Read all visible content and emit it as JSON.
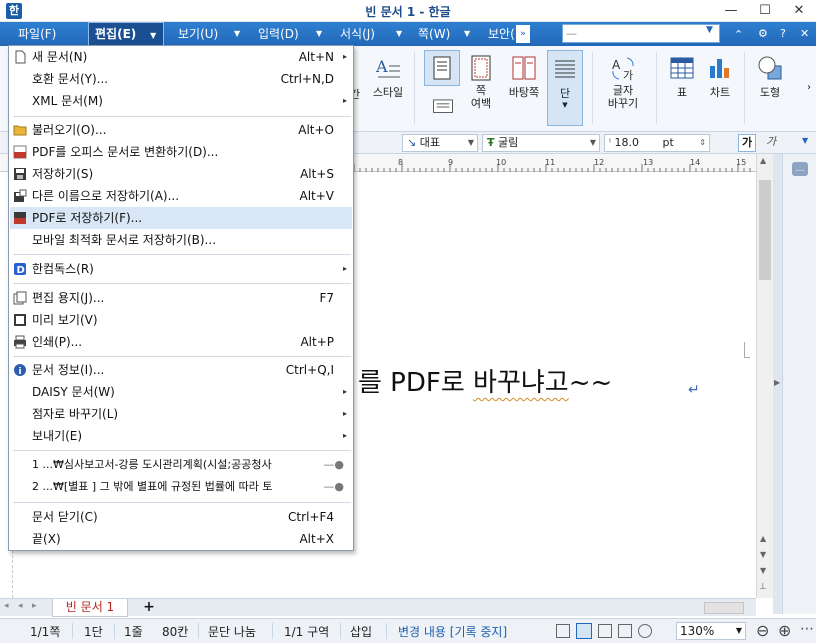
{
  "window": {
    "title": "빈 문서 1 - 한글",
    "app_icon_glyph": "한",
    "minimize": "—",
    "maximize": "☐",
    "close": "✕"
  },
  "menubar": {
    "items": [
      "파일(F)",
      "편집(E)",
      "보기(U)",
      "입력(D)",
      "서식(J)",
      "쪽(W)",
      "보안("
    ],
    "active_index": 1,
    "more_glyph": "»",
    "search_placeholder": "—",
    "right_controls": [
      "⌃",
      "⚙",
      "?",
      "✕"
    ]
  },
  "ribbon": {
    "buttons": [
      {
        "label": "스타일",
        "icon": "style-icon"
      },
      {
        "label": "",
        "icon": "page-layout-icon"
      },
      {
        "label": "쪽\n여백",
        "icon": "page-margin-icon"
      },
      {
        "label": "바탕쪽",
        "icon": "master-page-icon"
      },
      {
        "label": "단",
        "icon": "columns-icon"
      },
      {
        "label": "글자\n바꾸기",
        "icon": "char-replace-icon"
      },
      {
        "label": "표",
        "icon": "table-icon"
      },
      {
        "label": "차트",
        "icon": "chart-icon"
      },
      {
        "label": "도형",
        "icon": "shape-icon"
      }
    ],
    "partial_left_label": "간"
  },
  "formatbar": {
    "style": "대표",
    "font": "굴림",
    "size": "18.0",
    "unit": "pt",
    "bold_glyph": "가",
    "italic_glyph": "가"
  },
  "ruler": {
    "numbers": [
      "8",
      "9",
      "10",
      "11",
      "12",
      "13",
      "14",
      "15",
      "16"
    ]
  },
  "document": {
    "text_main": "를 PDF로 ",
    "text_spell": "바꾸냐고",
    "text_tail": "~~",
    "return_mark": "↵"
  },
  "tabs": {
    "doc_tab": "빈 문서 1",
    "add": "+"
  },
  "status": {
    "page": "1/1쪽",
    "section": "1단",
    "line": "1줄",
    "column": "80칸",
    "para": "문단 나눔",
    "area": "1/1 구역",
    "mode": "삽입",
    "track": "변경 내용 [기록 중지]",
    "zoom": "130%"
  },
  "file_menu": {
    "items": [
      {
        "label": "새 문서(N)",
        "shortcut": "Alt+N",
        "submenu": true,
        "icon": "new-doc-icon"
      },
      {
        "label": "호환 문서(Y)...",
        "shortcut": "Ctrl+N,D",
        "submenu": false,
        "icon": ""
      },
      {
        "label": "XML 문서(M)",
        "shortcut": "",
        "submenu": true,
        "icon": ""
      },
      {
        "label": "불러오기(O)...",
        "shortcut": "Alt+O",
        "submenu": false,
        "icon": "open-folder-icon"
      },
      {
        "label": "PDF를 오피스 문서로 변환하기(D)...",
        "shortcut": "",
        "submenu": false,
        "icon": "pdf-convert-icon"
      },
      {
        "label": "저장하기(S)",
        "shortcut": "Alt+S",
        "submenu": false,
        "icon": "save-icon"
      },
      {
        "label": "다른 이름으로 저장하기(A)...",
        "shortcut": "Alt+V",
        "submenu": false,
        "icon": "save-as-icon"
      },
      {
        "label": "PDF로 저장하기(F)...",
        "shortcut": "",
        "submenu": false,
        "icon": "save-pdf-icon"
      },
      {
        "label": "모바일 최적화 문서로 저장하기(B)...",
        "shortcut": "",
        "submenu": false,
        "icon": ""
      },
      {
        "label": "한컴독스(R)",
        "shortcut": "",
        "submenu": true,
        "icon": "hancom-docs-icon"
      },
      {
        "label": "편집 용지(J)...",
        "shortcut": "F7",
        "submenu": false,
        "icon": "page-setup-icon"
      },
      {
        "label": "미리 보기(V)",
        "shortcut": "",
        "submenu": false,
        "icon": "preview-icon"
      },
      {
        "label": "인쇄(P)...",
        "shortcut": "Alt+P",
        "submenu": false,
        "icon": "print-icon"
      },
      {
        "label": "문서 정보(I)...",
        "shortcut": "Ctrl+Q,I",
        "submenu": false,
        "icon": "info-icon"
      },
      {
        "label": "DAISY 문서(W)",
        "shortcut": "",
        "submenu": true,
        "icon": ""
      },
      {
        "label": "점자로 바꾸기(L)",
        "shortcut": "",
        "submenu": true,
        "icon": ""
      },
      {
        "label": "보내기(E)",
        "shortcut": "",
        "submenu": true,
        "icon": ""
      },
      {
        "label": "1 ...₩심사보고서-강릉 도시관리계획(시설;공공청사",
        "shortcut": "",
        "submenu": false,
        "icon": "",
        "pin": "—●"
      },
      {
        "label": "2 ...₩[별표 ] 그 밖에 별표에 규정된 법률에 따라 토",
        "shortcut": "",
        "submenu": false,
        "icon": "",
        "pin": "—●"
      },
      {
        "label": "문서 닫기(C)",
        "shortcut": "Ctrl+F4",
        "submenu": false,
        "icon": ""
      },
      {
        "label": "끝(X)",
        "shortcut": "Alt+X",
        "submenu": false,
        "icon": ""
      }
    ],
    "highlighted_index": 7
  }
}
